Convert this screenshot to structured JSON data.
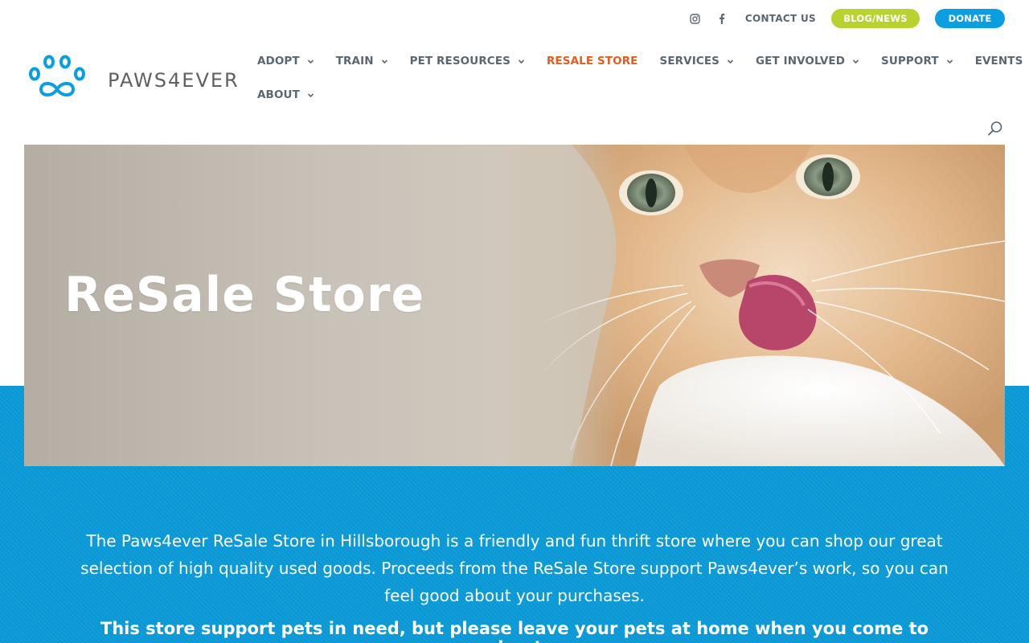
{
  "topbar": {
    "instagram_icon": "instagram-icon",
    "facebook_icon": "facebook-icon",
    "contact_label": "CONTACT US",
    "blog_label": "BLOG/NEWS",
    "donate_label": "DONATE",
    "colors": {
      "blog": "#b8d22f",
      "donate": "#0a9fe0"
    }
  },
  "logo": {
    "text": "PAWS4EVER",
    "icon": "paw-infinity-icon",
    "color": "#0a9fe0"
  },
  "nav": {
    "items": [
      {
        "label": "ADOPT"
      },
      {
        "label": "TRAIN"
      },
      {
        "label": "PET RESOURCES"
      },
      {
        "label": "RESALE STORE",
        "active": true
      },
      {
        "label": "SERVICES"
      },
      {
        "label": "GET INVOLVED"
      },
      {
        "label": "SUPPORT"
      },
      {
        "label": "EVENTS"
      },
      {
        "label": "ABOUT"
      }
    ],
    "active_color": "#e65a1a",
    "search_icon": "search-icon"
  },
  "hero": {
    "title": "ReSale Store"
  },
  "content": {
    "intro": "The Paws4ever ReSale Store in Hillsborough is a friendly and fun thrift store where you can shop our great selection of high quality used goods. Proceeds from the ReSale Store support Paws4ever’s work, so you can feel good about your purchases.",
    "notice": "This store support pets in need, but please leave your pets at home when you come to shop!",
    "background_color": "#0a9ad7"
  }
}
